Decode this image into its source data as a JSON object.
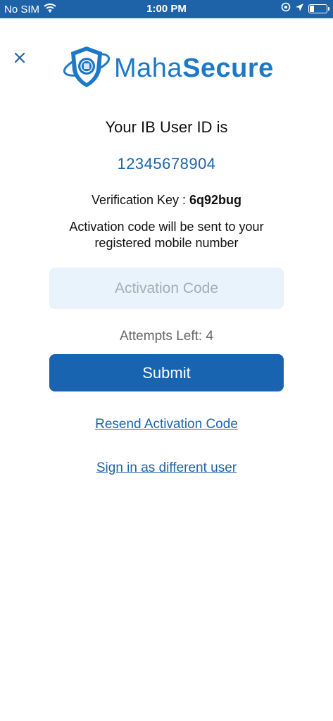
{
  "status_bar": {
    "carrier": "No SIM",
    "time": "1:00 PM",
    "battery_level": 0.25,
    "icons": [
      "wifi-icon",
      "screen-lock-rotation-icon",
      "location-arrow-icon",
      "battery-icon"
    ]
  },
  "header": {
    "close_icon": "close-icon",
    "logo": {
      "word1": "Maha",
      "word2": "Secure",
      "emblem": "shield-emblem-icon"
    }
  },
  "content": {
    "ib_label": "Your IB User ID is",
    "user_id": "12345678904",
    "verification_label": "Verification Key : ",
    "verification_key": "6q92bug",
    "info_line1": "Activation code will be sent to your",
    "info_line2": "registered mobile number"
  },
  "form": {
    "activation_placeholder": "Activation Code",
    "activation_value": "",
    "attempts_text": "Attempts Left: 4",
    "submit_label": "Submit"
  },
  "links": {
    "resend": "Resend Activation Code",
    "signin_different": "Sign in as different user"
  },
  "colors": {
    "primary": "#1864b0",
    "status_bar": "#1e63a8",
    "input_bg": "#e8f3fb",
    "logo_blue": "#1e78c8"
  }
}
